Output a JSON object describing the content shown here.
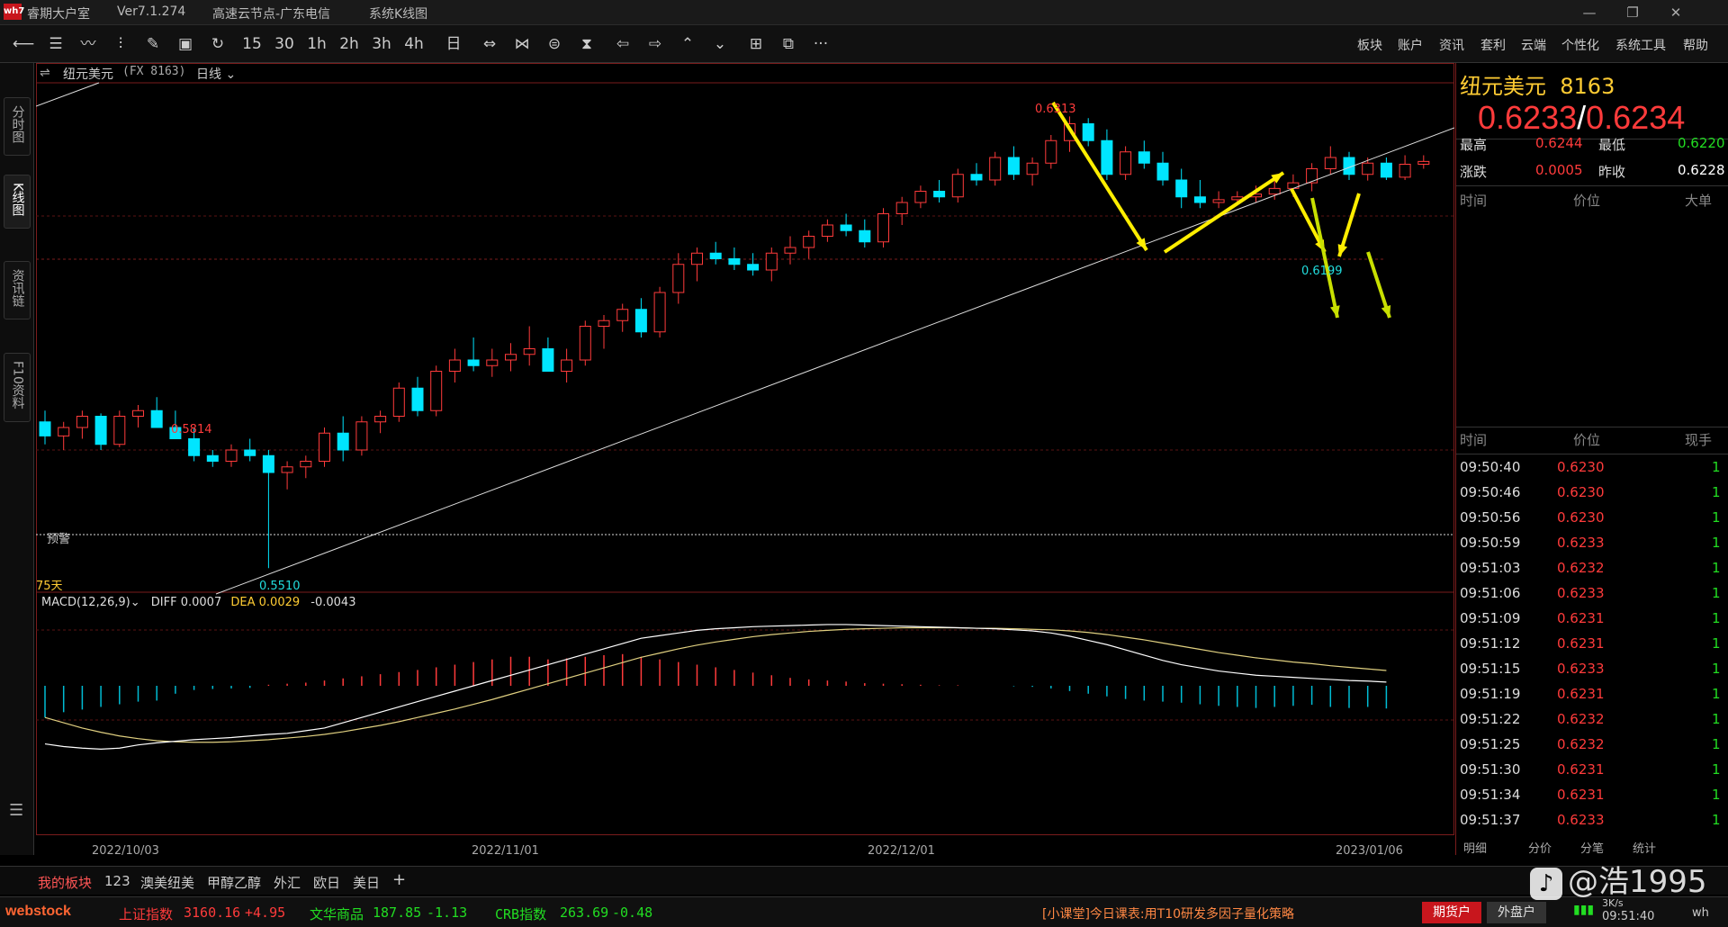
{
  "window": {
    "app_logo": "wh7",
    "app_name": "睿期大户室",
    "version": "Ver7.1.274",
    "server": "高速云节点-广东电信",
    "view_name": "系统K线图"
  },
  "toolbar": {
    "icons": [
      "back-icon",
      "list-icon",
      "line-chart-icon",
      "kline-icon",
      "draw-icon",
      "save-icon",
      "refresh-icon"
    ],
    "periods": [
      "15",
      "30",
      "1h",
      "2h",
      "3h",
      "4h",
      "日"
    ],
    "menu": [
      "板块",
      "账户",
      "资讯",
      "套利",
      "云端",
      "个性化",
      "系统工具",
      "帮助"
    ],
    "more": "···"
  },
  "left_rail": {
    "tabs": [
      {
        "label": "分时图"
      },
      {
        "label": "K线图"
      },
      {
        "label": "资讯链"
      },
      {
        "label": "F10资料"
      }
    ],
    "menu_icon": "menu-icon"
  },
  "chart_header": {
    "symbol": "纽元美元",
    "code": "(FX 8163)",
    "period": "日线"
  },
  "chart_annotations": {
    "high_label": "0.6313",
    "left_high": "0.5814",
    "low_label": "0.5510",
    "right_low": "0.6199",
    "alert": "预警",
    "days": "75天"
  },
  "macd_header": {
    "name": "MACD(12,26,9)",
    "diff_label": "DIFF",
    "diff": "0.0007",
    "dea_label": "DEA",
    "dea": "0.0029",
    "macd": "-0.0043"
  },
  "x_axis": {
    "labels": [
      "2022/10/03",
      "2022/11/01",
      "2022/12/01",
      "2023/01/06"
    ]
  },
  "quote": {
    "name": "纽元美元",
    "code": "8163",
    "bid": "0.6233",
    "sep": "/",
    "ask": "0.6234",
    "high_label": "最高",
    "high": "0.6244",
    "low_label": "最低",
    "low": "0.6220",
    "change_label": "涨跌",
    "change": "0.0005",
    "prev_close_label": "昨收",
    "prev_close": "0.6228"
  },
  "big_orders": {
    "headers": [
      "时间",
      "价位",
      "大单"
    ]
  },
  "ticks": {
    "headers": [
      "时间",
      "价位",
      "现手"
    ],
    "rows": [
      {
        "time": "09:50:40",
        "price": "0.6230",
        "qty": "1"
      },
      {
        "time": "09:50:46",
        "price": "0.6230",
        "qty": "1"
      },
      {
        "time": "09:50:56",
        "price": "0.6230",
        "qty": "1"
      },
      {
        "time": "09:50:59",
        "price": "0.6233",
        "qty": "1"
      },
      {
        "time": "09:51:03",
        "price": "0.6232",
        "qty": "1"
      },
      {
        "time": "09:51:06",
        "price": "0.6233",
        "qty": "1"
      },
      {
        "time": "09:51:09",
        "price": "0.6231",
        "qty": "1"
      },
      {
        "time": "09:51:12",
        "price": "0.6231",
        "qty": "1"
      },
      {
        "time": "09:51:15",
        "price": "0.6233",
        "qty": "1"
      },
      {
        "time": "09:51:19",
        "price": "0.6231",
        "qty": "1"
      },
      {
        "time": "09:51:22",
        "price": "0.6232",
        "qty": "1"
      },
      {
        "time": "09:51:25",
        "price": "0.6232",
        "qty": "1"
      },
      {
        "time": "09:51:30",
        "price": "0.6231",
        "qty": "1"
      },
      {
        "time": "09:51:34",
        "price": "0.6231",
        "qty": "1"
      },
      {
        "time": "09:51:37",
        "price": "0.6233",
        "qty": "1"
      }
    ],
    "footer_tabs": [
      "明细",
      "分价",
      "分笔",
      "统计"
    ]
  },
  "bottom_tabs": [
    "我的板块",
    "123",
    "澳美纽美",
    "甲醇乙醇",
    "外汇",
    "欧日",
    "美日",
    "+"
  ],
  "status": {
    "brand": "webstock",
    "index1_name": "上证指数",
    "index1_value": "3160.16",
    "index1_change": "+4.95",
    "index2_name": "文华商品",
    "index2_value": "187.85",
    "index2_change": "-1.13",
    "index3_name": "CRB指数",
    "index3_value": "263.69",
    "index3_change": "-0.48",
    "news": "[小课堂]今日课表:用T10研发多因子量化策略",
    "btn_futures": "期货户",
    "btn_external": "外盘户",
    "speed": "3K/s",
    "clock": "09:51:40",
    "tail": "wh"
  },
  "watermark": "@浩1995",
  "colors": {
    "up": "#ff3b3b",
    "down": "#00e5ff",
    "accent_yellow": "#ffcc33",
    "green": "#22dd22"
  },
  "chart_data": {
    "type": "candlestick",
    "ylim": [
      0.548,
      0.636
    ],
    "candles": [
      [
        0.577,
        0.579,
        0.573,
        0.5745
      ],
      [
        0.5745,
        0.577,
        0.572,
        0.576
      ],
      [
        0.576,
        0.579,
        0.574,
        0.578
      ],
      [
        0.578,
        0.5785,
        0.572,
        0.573
      ],
      [
        0.573,
        0.579,
        0.5725,
        0.578
      ],
      [
        0.578,
        0.58,
        0.576,
        0.579
      ],
      [
        0.579,
        0.5814,
        0.577,
        0.576
      ],
      [
        0.576,
        0.579,
        0.574,
        0.574
      ],
      [
        0.574,
        0.576,
        0.57,
        0.571
      ],
      [
        0.571,
        0.572,
        0.569,
        0.57
      ],
      [
        0.57,
        0.573,
        0.569,
        0.572
      ],
      [
        0.572,
        0.574,
        0.57,
        0.571
      ],
      [
        0.571,
        0.572,
        0.551,
        0.568
      ],
      [
        0.568,
        0.57,
        0.565,
        0.569
      ],
      [
        0.569,
        0.571,
        0.567,
        0.57
      ],
      [
        0.57,
        0.576,
        0.569,
        0.575
      ],
      [
        0.575,
        0.578,
        0.57,
        0.572
      ],
      [
        0.572,
        0.578,
        0.571,
        0.577
      ],
      [
        0.577,
        0.579,
        0.575,
        0.578
      ],
      [
        0.578,
        0.584,
        0.577,
        0.583
      ],
      [
        0.583,
        0.585,
        0.578,
        0.579
      ],
      [
        0.579,
        0.587,
        0.578,
        0.586
      ],
      [
        0.586,
        0.59,
        0.584,
        0.588
      ],
      [
        0.588,
        0.592,
        0.586,
        0.587
      ],
      [
        0.587,
        0.59,
        0.585,
        0.588
      ],
      [
        0.588,
        0.591,
        0.586,
        0.589
      ],
      [
        0.589,
        0.594,
        0.587,
        0.59
      ],
      [
        0.59,
        0.592,
        0.588,
        0.586
      ],
      [
        0.586,
        0.59,
        0.584,
        0.588
      ],
      [
        0.588,
        0.595,
        0.587,
        0.594
      ],
      [
        0.594,
        0.596,
        0.59,
        0.595
      ],
      [
        0.595,
        0.598,
        0.593,
        0.597
      ],
      [
        0.597,
        0.599,
        0.592,
        0.593
      ],
      [
        0.593,
        0.601,
        0.592,
        0.6
      ],
      [
        0.6,
        0.607,
        0.598,
        0.605
      ],
      [
        0.605,
        0.608,
        0.602,
        0.607
      ],
      [
        0.607,
        0.609,
        0.605,
        0.606
      ],
      [
        0.606,
        0.608,
        0.604,
        0.605
      ],
      [
        0.605,
        0.607,
        0.603,
        0.604
      ],
      [
        0.604,
        0.608,
        0.602,
        0.607
      ],
      [
        0.607,
        0.61,
        0.605,
        0.608
      ],
      [
        0.608,
        0.611,
        0.606,
        0.61
      ],
      [
        0.61,
        0.613,
        0.609,
        0.612
      ],
      [
        0.612,
        0.614,
        0.61,
        0.611
      ],
      [
        0.611,
        0.613,
        0.608,
        0.609
      ],
      [
        0.609,
        0.615,
        0.608,
        0.614
      ],
      [
        0.614,
        0.617,
        0.612,
        0.616
      ],
      [
        0.616,
        0.619,
        0.615,
        0.618
      ],
      [
        0.618,
        0.62,
        0.616,
        0.617
      ],
      [
        0.617,
        0.622,
        0.616,
        0.621
      ],
      [
        0.621,
        0.623,
        0.619,
        0.62
      ],
      [
        0.62,
        0.625,
        0.619,
        0.624
      ],
      [
        0.624,
        0.626,
        0.62,
        0.621
      ],
      [
        0.621,
        0.624,
        0.619,
        0.623
      ],
      [
        0.623,
        0.628,
        0.622,
        0.627
      ],
      [
        0.627,
        0.6313,
        0.625,
        0.63
      ],
      [
        0.63,
        0.631,
        0.626,
        0.627
      ],
      [
        0.627,
        0.629,
        0.62,
        0.621
      ],
      [
        0.621,
        0.626,
        0.62,
        0.625
      ],
      [
        0.625,
        0.627,
        0.622,
        0.623
      ],
      [
        0.623,
        0.625,
        0.619,
        0.62
      ],
      [
        0.62,
        0.622,
        0.615,
        0.617
      ],
      [
        0.617,
        0.62,
        0.615,
        0.616
      ],
      [
        0.616,
        0.618,
        0.615,
        0.6165
      ],
      [
        0.6165,
        0.618,
        0.6155,
        0.617
      ],
      [
        0.617,
        0.619,
        0.616,
        0.6175
      ],
      [
        0.6175,
        0.62,
        0.6165,
        0.6185
      ],
      [
        0.6185,
        0.621,
        0.617,
        0.6195
      ],
      [
        0.6195,
        0.623,
        0.618,
        0.622
      ],
      [
        0.622,
        0.626,
        0.621,
        0.624
      ],
      [
        0.624,
        0.625,
        0.62,
        0.621
      ],
      [
        0.621,
        0.624,
        0.6199,
        0.623
      ],
      [
        0.623,
        0.624,
        0.62,
        0.6205
      ],
      [
        0.6205,
        0.6244,
        0.62,
        0.6228
      ],
      [
        0.6228,
        0.6244,
        0.622,
        0.6233
      ]
    ],
    "macd_hist": [
      -0.006,
      -0.005,
      -0.0045,
      -0.004,
      -0.0035,
      -0.003,
      -0.0028,
      -0.0015,
      -0.0008,
      -0.0006,
      -0.0005,
      -0.0004,
      0.0002,
      0.0004,
      0.0006,
      0.001,
      0.0014,
      0.0018,
      0.0022,
      0.0026,
      0.003,
      0.0035,
      0.004,
      0.0045,
      0.005,
      0.0055,
      0.0055,
      0.005,
      0.0052,
      0.0055,
      0.0058,
      0.006,
      0.0055,
      0.005,
      0.0045,
      0.004,
      0.0035,
      0.003,
      0.0025,
      0.002,
      0.0015,
      0.0012,
      0.001,
      0.0008,
      0.0005,
      0.0004,
      0.0003,
      0.0002,
      0.0001,
      0.0001,
      0.0,
      0.0,
      -0.0001,
      -0.0002,
      -0.0005,
      -0.001,
      -0.0015,
      -0.002,
      -0.0025,
      -0.0028,
      -0.003,
      -0.0032,
      -0.0035,
      -0.0038,
      -0.004,
      -0.0042,
      -0.004,
      -0.0038,
      -0.0036,
      -0.004,
      -0.0042,
      -0.004,
      -0.0043
    ],
    "diff": [
      -0.011,
      -0.0115,
      -0.0118,
      -0.012,
      -0.0118,
      -0.0112,
      -0.0108,
      -0.0105,
      -0.0102,
      -0.01,
      -0.0098,
      -0.0095,
      -0.0092,
      -0.009,
      -0.0085,
      -0.008,
      -0.007,
      -0.006,
      -0.005,
      -0.004,
      -0.003,
      -0.002,
      -0.001,
      0.0,
      0.001,
      0.002,
      0.003,
      0.004,
      0.005,
      0.006,
      0.007,
      0.008,
      0.009,
      0.0095,
      0.01,
      0.0105,
      0.0108,
      0.011,
      0.0112,
      0.0113,
      0.0114,
      0.0115,
      0.0116,
      0.0116,
      0.0115,
      0.0114,
      0.0113,
      0.0112,
      0.0111,
      0.011,
      0.0109,
      0.0108,
      0.0106,
      0.0104,
      0.01,
      0.0094,
      0.0086,
      0.0078,
      0.0068,
      0.0058,
      0.0048,
      0.004,
      0.0034,
      0.0028,
      0.0024,
      0.002,
      0.0018,
      0.0016,
      0.0014,
      0.0012,
      0.001,
      0.0009,
      0.0007
    ],
    "dea": [
      -0.006,
      -0.007,
      -0.008,
      -0.0088,
      -0.0095,
      -0.01,
      -0.0104,
      -0.0106,
      -0.0107,
      -0.0107,
      -0.0106,
      -0.0104,
      -0.0102,
      -0.0099,
      -0.0096,
      -0.0092,
      -0.0087,
      -0.0081,
      -0.0075,
      -0.0068,
      -0.006,
      -0.0052,
      -0.0044,
      -0.0035,
      -0.0026,
      -0.0016,
      -0.0006,
      0.0004,
      0.0014,
      0.0024,
      0.0034,
      0.0044,
      0.0054,
      0.0062,
      0.007,
      0.0077,
      0.0083,
      0.0088,
      0.0093,
      0.0097,
      0.01,
      0.0103,
      0.0105,
      0.0107,
      0.0108,
      0.0109,
      0.011,
      0.011,
      0.011,
      0.011,
      0.0109,
      0.0109,
      0.0108,
      0.0107,
      0.0106,
      0.0104,
      0.0101,
      0.0097,
      0.0092,
      0.0087,
      0.0081,
      0.0075,
      0.0069,
      0.0063,
      0.0058,
      0.0053,
      0.0049,
      0.0045,
      0.0042,
      0.0038,
      0.0035,
      0.0032,
      0.0029
    ],
    "macd_ylim": [
      -0.015,
      0.015
    ]
  }
}
